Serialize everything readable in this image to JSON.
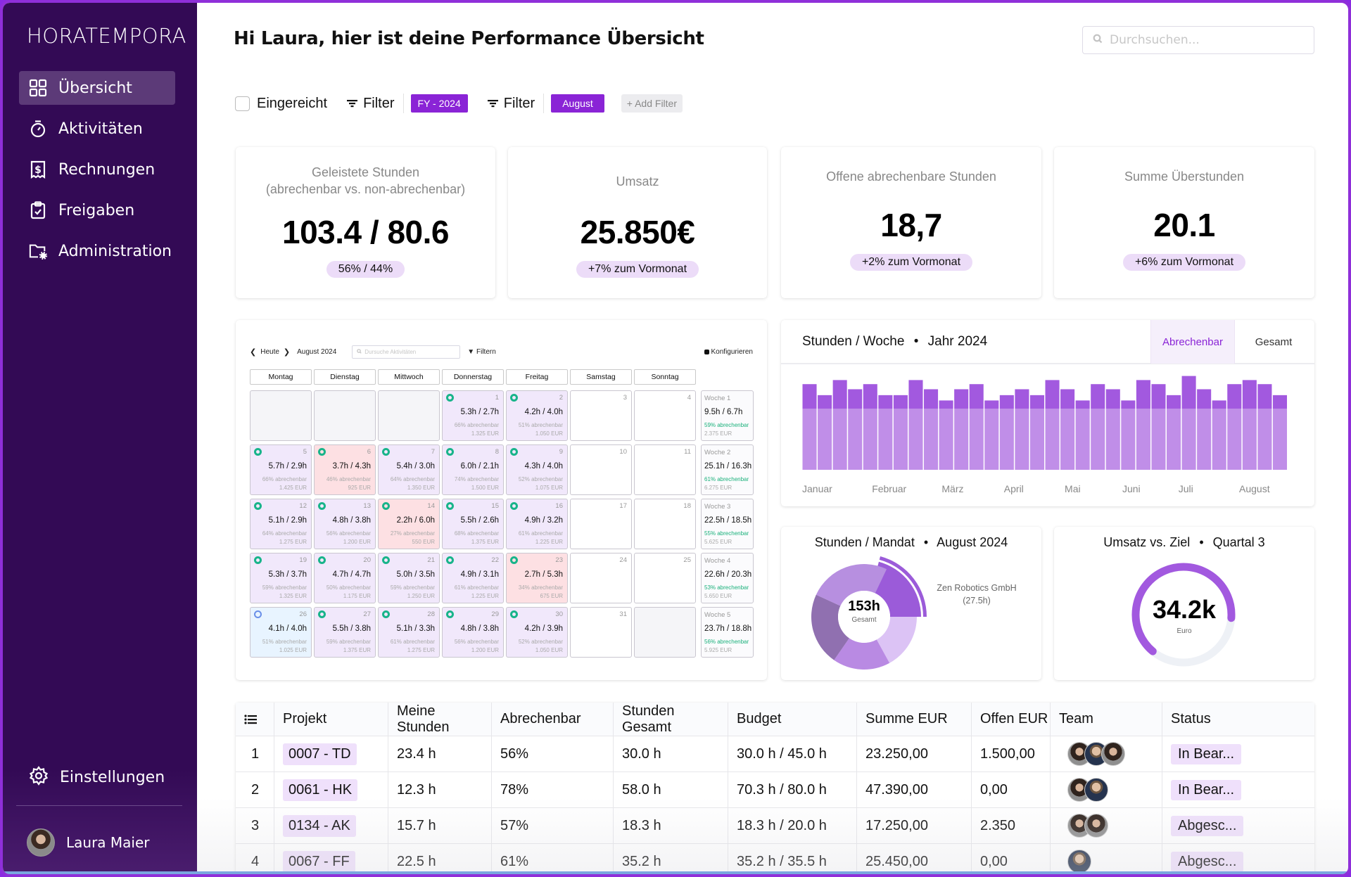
{
  "app": {
    "brand": "HORATEMPORA"
  },
  "sidebar": {
    "items": [
      {
        "label": "Übersicht",
        "icon": "dashboard-grid-icon",
        "active": true
      },
      {
        "label": "Aktivitäten",
        "icon": "stopwatch-icon",
        "active": false
      },
      {
        "label": "Rechnungen",
        "icon": "invoice-dollar-icon",
        "active": false
      },
      {
        "label": "Freigaben",
        "icon": "clipboard-check-icon",
        "active": false
      },
      {
        "label": "Administration",
        "icon": "folder-gear-icon",
        "active": false
      }
    ],
    "settings_label": "Einstellungen",
    "user_name": "Laura Maier"
  },
  "header": {
    "title": "Hi Laura, hier ist deine Performance Übersicht",
    "search_placeholder": "Durchsuchen..."
  },
  "filters": {
    "submitted_label": "Eingereicht",
    "submitted_checked": false,
    "filter1_label": "Filter",
    "filter1_value": "FY - 2024",
    "filter2_label": "Filter",
    "filter2_value": "August",
    "add_filter_label": "+ Add Filter"
  },
  "kpis": [
    {
      "title_line1": "Geleistete Stunden",
      "title_line2": "(abrechenbar vs. non-abrechenbar)",
      "value": "103.4 / 80.6",
      "badge": "56% / 44%"
    },
    {
      "title_line1": "Umsatz",
      "title_line2": "",
      "value": "25.850€",
      "badge": "+7% zum Vormonat"
    },
    {
      "title_line1": "Offene abrechenbare Stunden",
      "title_line2": "",
      "value": "18,7",
      "badge": "+2% zum Vormonat"
    },
    {
      "title_line1": "Summe Überstunden",
      "title_line2": "",
      "value": "20.1",
      "badge": "+6% zum Vormonat"
    }
  ],
  "calendar": {
    "today_label": "Heute",
    "month_label": "August 2024",
    "search_placeholder": "Dursuche Aktivitäten",
    "filter_label": "Filtern",
    "configure_label": "Konfigurieren",
    "weekdays": [
      "Montag",
      "Dienstag",
      "Mittwoch",
      "Donnerstag",
      "Freitag",
      "Samstag",
      "Sonntag"
    ],
    "weeks": [
      {
        "days": [
          {
            "type": "empty"
          },
          {
            "type": "empty"
          },
          {
            "type": "empty"
          },
          {
            "type": "work",
            "num": "1",
            "hrs": "5.3h / 2.7h",
            "pct": "66% abrechenbar",
            "eur": "1.325 EUR"
          },
          {
            "type": "work",
            "num": "2",
            "hrs": "4.2h / 4.0h",
            "pct": "51% abrechenbar",
            "eur": "1.050 EUR"
          },
          {
            "type": "off",
            "num": "3"
          },
          {
            "type": "off",
            "num": "4"
          }
        ],
        "summary": {
          "label": "Woche 1",
          "hrs": "9.5h / 6.7h",
          "pct": "59% abrechenbar",
          "eur": "2.375 EUR"
        }
      },
      {
        "days": [
          {
            "type": "work",
            "num": "5",
            "hrs": "5.7h / 2.9h",
            "pct": "66% abrechenbar",
            "eur": "1.425 EUR"
          },
          {
            "type": "low",
            "num": "6",
            "hrs": "3.7h / 4.3h",
            "pct": "46% abrechenbar",
            "eur": "925 EUR"
          },
          {
            "type": "work",
            "num": "7",
            "hrs": "5.4h / 3.0h",
            "pct": "64% abrechenbar",
            "eur": "1.350 EUR"
          },
          {
            "type": "work",
            "num": "8",
            "hrs": "6.0h / 2.1h",
            "pct": "74% abrechenbar",
            "eur": "1.500 EUR"
          },
          {
            "type": "work",
            "num": "9",
            "hrs": "4.3h / 4.0h",
            "pct": "52% abrechenbar",
            "eur": "1.075 EUR"
          },
          {
            "type": "off",
            "num": "10"
          },
          {
            "type": "off",
            "num": "11"
          }
        ],
        "summary": {
          "label": "Woche 2",
          "hrs": "25.1h / 16.3h",
          "pct": "61% abrechenbar",
          "eur": "6.275 EUR"
        }
      },
      {
        "days": [
          {
            "type": "work",
            "num": "12",
            "hrs": "5.1h / 2.9h",
            "pct": "64% abrechenbar",
            "eur": "1.275 EUR"
          },
          {
            "type": "work",
            "num": "13",
            "hrs": "4.8h / 3.8h",
            "pct": "56% abrechenbar",
            "eur": "1.200 EUR"
          },
          {
            "type": "low",
            "num": "14",
            "hrs": "2.2h / 6.0h",
            "pct": "27% abrechenbar",
            "eur": "550 EUR"
          },
          {
            "type": "work",
            "num": "15",
            "hrs": "5.5h / 2.6h",
            "pct": "68% abrechenbar",
            "eur": "1.375 EUR"
          },
          {
            "type": "work",
            "num": "16",
            "hrs": "4.9h / 3.2h",
            "pct": "61% abrechenbar",
            "eur": "1.225 EUR"
          },
          {
            "type": "off",
            "num": "17"
          },
          {
            "type": "off",
            "num": "18"
          }
        ],
        "summary": {
          "label": "Woche 3",
          "hrs": "22.5h / 18.5h",
          "pct": "55% abrechenbar",
          "eur": "5.625 EUR"
        }
      },
      {
        "days": [
          {
            "type": "work",
            "num": "19",
            "hrs": "5.3h / 3.7h",
            "pct": "59% abrechenbar",
            "eur": "1.325 EUR"
          },
          {
            "type": "work",
            "num": "20",
            "hrs": "4.7h / 4.7h",
            "pct": "50% abrechenbar",
            "eur": "1.175 EUR"
          },
          {
            "type": "work",
            "num": "21",
            "hrs": "5.0h / 3.5h",
            "pct": "59% abrechenbar",
            "eur": "1.250 EUR"
          },
          {
            "type": "work",
            "num": "22",
            "hrs": "4.9h / 3.1h",
            "pct": "61% abrechenbar",
            "eur": "1.225 EUR"
          },
          {
            "type": "low",
            "num": "23",
            "hrs": "2.7h / 5.3h",
            "pct": "34% abrechenbar",
            "eur": "675 EUR"
          },
          {
            "type": "off",
            "num": "24"
          },
          {
            "type": "off",
            "num": "25"
          }
        ],
        "summary": {
          "label": "Woche 4",
          "hrs": "22.6h / 20.3h",
          "pct": "53% abrechenbar",
          "eur": "5.650 EUR"
        }
      },
      {
        "days": [
          {
            "type": "pending",
            "num": "26",
            "hrs": "4.1h / 4.0h",
            "pct": "51% abrechenbar",
            "eur": "1.025 EUR"
          },
          {
            "type": "work",
            "num": "27",
            "hrs": "5.5h / 3.8h",
            "pct": "59% abrechenbar",
            "eur": "1.375 EUR"
          },
          {
            "type": "work",
            "num": "28",
            "hrs": "5.1h / 3.3h",
            "pct": "61% abrechenbar",
            "eur": "1.275 EUR"
          },
          {
            "type": "work",
            "num": "29",
            "hrs": "4.8h / 3.8h",
            "pct": "56% abrechenbar",
            "eur": "1.200 EUR"
          },
          {
            "type": "work",
            "num": "30",
            "hrs": "4.2h / 3.9h",
            "pct": "52% abrechenbar",
            "eur": "1.050 EUR"
          },
          {
            "type": "off",
            "num": "31"
          },
          {
            "type": "empty"
          }
        ],
        "summary": {
          "label": "Woche 5",
          "hrs": "23.7h / 18.8h",
          "pct": "56% abrechenbar",
          "eur": "5.925 EUR"
        }
      }
    ]
  },
  "chart_data": [
    {
      "type": "bar",
      "title": "Stunden / Woche",
      "subtitle": "Jahr 2024",
      "tabs": [
        "Abrechenbar",
        "Gesamt"
      ],
      "active_tab": "Abrechenbar",
      "x_tick_labels": [
        "Januar",
        "Februar",
        "März",
        "April",
        "Mai",
        "Juni",
        "Juli",
        "August"
      ],
      "stacked": true,
      "series": [
        {
          "name": "base",
          "color": "#c08ee8",
          "values": [
            30,
            30,
            30,
            30,
            30,
            30,
            30,
            30,
            30,
            30,
            30,
            30,
            30,
            30,
            30,
            30,
            30,
            30,
            30,
            30,
            30,
            30,
            30,
            30,
            30,
            30,
            30,
            30,
            30,
            30,
            30,
            30
          ]
        },
        {
          "name": "top",
          "color": "#a259df",
          "values": [
            12,
            6.6,
            14,
            9.5,
            12,
            6.6,
            6.6,
            14,
            9.5,
            4,
            9.5,
            12,
            4,
            6.6,
            9.5,
            6.6,
            14,
            9.5,
            4,
            12,
            9.5,
            4,
            14,
            12,
            6.6,
            16,
            9.5,
            4,
            12,
            14,
            12,
            6.6
          ]
        }
      ],
      "ylim": [
        0,
        50
      ],
      "grid": false
    },
    {
      "type": "pie",
      "title": "Stunden / Mandat",
      "subtitle": "August 2024",
      "center_value": "153h",
      "center_label": "Gesamt",
      "highlight_label": "Zen Robotics GmbH",
      "highlight_value_label": "(27.5h)",
      "slices": [
        {
          "name": "Zen Robotics GmbH",
          "value": 27.5,
          "color": "#9b5bd9",
          "highlight": true
        },
        {
          "name": "Mandat B",
          "value": 26,
          "color": "#dcc3f5"
        },
        {
          "name": "Mandat C",
          "value": 27,
          "color": "#b98ae3"
        },
        {
          "name": "Mandat D",
          "value": 34,
          "color": "#9070b0"
        },
        {
          "name": "Mandat E",
          "value": 38.5,
          "color": "#b78fe0"
        }
      ]
    },
    {
      "type": "gauge",
      "title": "Umsatz vs. Ziel",
      "subtitle": "Quartal 3",
      "center_value": "34.2k",
      "center_label": "Euro",
      "progress": 0.65,
      "color": "#a259df",
      "track_color": "#eef1f6"
    }
  ],
  "table": {
    "columns": [
      "",
      "Projekt",
      "Meine Stunden",
      "Abrechenbar",
      "Stunden Gesamt",
      "Budget",
      "Summe EUR",
      "Offen EUR",
      "Team",
      "Status"
    ],
    "rows": [
      {
        "idx": "1",
        "project": "0007 - TD",
        "my_hours": "23.4 h",
        "billable": "56%",
        "total_hours": "30.0 h",
        "budget": "30.0 h / 45.0 h",
        "sum_eur": "23.250,00",
        "open_eur": "1.500,00",
        "team": [
          "f",
          "m",
          "f"
        ],
        "status": "In Bear..."
      },
      {
        "idx": "2",
        "project": "0061 - HK",
        "my_hours": "12.3 h",
        "billable": "78%",
        "total_hours": "58.0 h",
        "budget": "70.3 h / 80.0 h",
        "sum_eur": "47.390,00",
        "open_eur": "0,00",
        "team": [
          "f",
          "m"
        ],
        "status": "In Bear..."
      },
      {
        "idx": "3",
        "project": "0134 - AK",
        "my_hours": "15.7 h",
        "billable": "57%",
        "total_hours": "18.3 h",
        "budget": "18.3 h / 20.0 h",
        "sum_eur": "17.250,00",
        "open_eur": "2.350",
        "team": [
          "f",
          "f"
        ],
        "status": "Abgesc..."
      },
      {
        "idx": "4",
        "project": "0067 - FF",
        "my_hours": "22.5 h",
        "billable": "61%",
        "total_hours": "35.2 h",
        "budget": "35.2 h / 35.5 h",
        "sum_eur": "25.450,00",
        "open_eur": "0,00",
        "team": [
          "m"
        ],
        "status": "Abgesc..."
      }
    ]
  },
  "colors": {
    "sidebar_bg": "#330a55",
    "accent": "#8a24d6",
    "badge_bg": "#ecdcf8",
    "success": "#18b48a",
    "warning_cell": "#fde0e3"
  }
}
